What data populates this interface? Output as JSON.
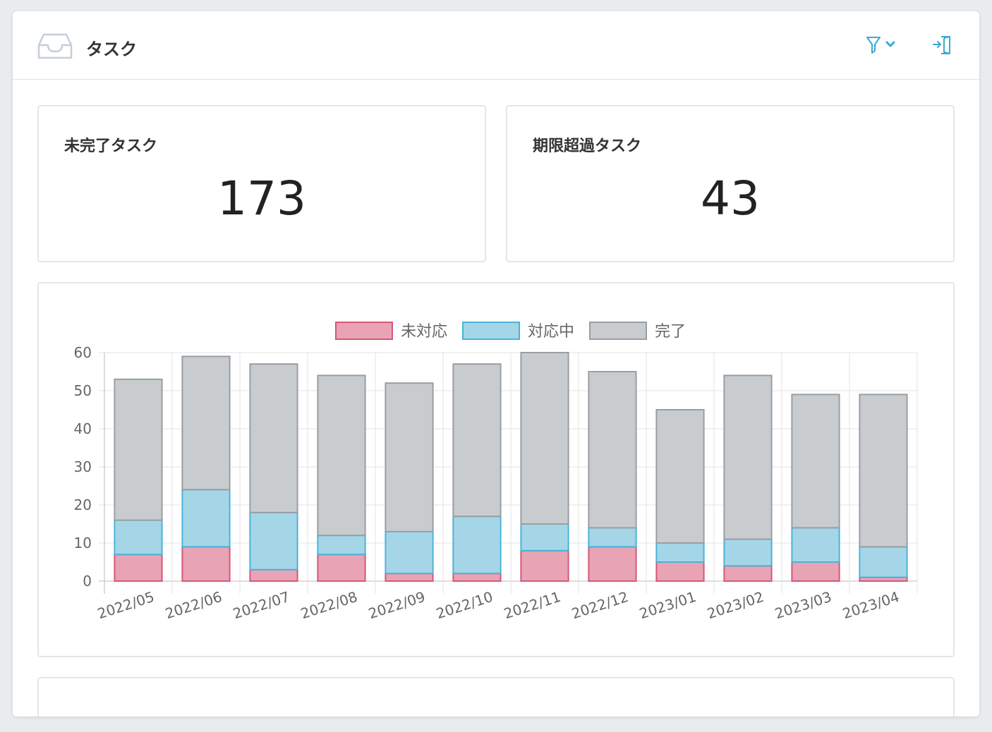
{
  "header": {
    "title": "タスク",
    "icons": {
      "app": "inbox-tray-icon",
      "filter": "filter-icon",
      "filter_toggle": "chevron-down-icon",
      "logout": "logout-door-icon"
    },
    "accent_color": "#3aa9d6"
  },
  "stats": {
    "incomplete": {
      "label": "未完了タスク",
      "value": "173"
    },
    "overdue": {
      "label": "期限超過タスク",
      "value": "43"
    }
  },
  "chart_data": {
    "type": "bar",
    "stacked": true,
    "categories": [
      "2022/05",
      "2022/06",
      "2022/07",
      "2022/08",
      "2022/09",
      "2022/10",
      "2022/11",
      "2022/12",
      "2023/01",
      "2023/02",
      "2023/03",
      "2023/04"
    ],
    "series": [
      {
        "name": "未対応",
        "values": [
          7,
          9,
          3,
          7,
          2,
          2,
          8,
          9,
          5,
          4,
          5,
          1
        ],
        "color": "#e8a4b4",
        "stroke": "#d6577a"
      },
      {
        "name": "対応中",
        "values": [
          9,
          15,
          15,
          5,
          11,
          15,
          7,
          5,
          5,
          7,
          9,
          8
        ],
        "color": "#a5d6e8",
        "stroke": "#4ab3d8"
      },
      {
        "name": "完了",
        "values": [
          37,
          35,
          39,
          42,
          39,
          40,
          45,
          41,
          35,
          43,
          35,
          40
        ],
        "color": "#c9cccf",
        "stroke": "#9a9ea3"
      }
    ],
    "ylim": [
      0,
      60
    ],
    "yticks": [
      0,
      10,
      20,
      30,
      40,
      50,
      60
    ],
    "grid": true,
    "legend": "top"
  }
}
